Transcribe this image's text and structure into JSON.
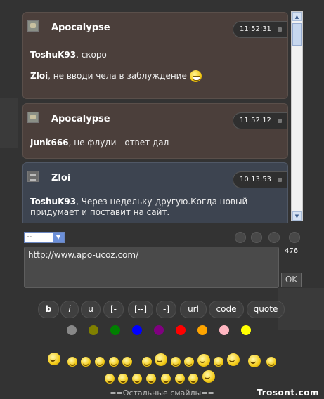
{
  "messages": [
    {
      "author": "Apocalypse",
      "time": "11:52:31",
      "lines": [
        {
          "nick": "ToshuK93",
          "text": ", скоро"
        },
        {
          "nick": "Zloi",
          "text": ", не вводи чела в заблуждение",
          "smiley": "grin-icon"
        }
      ],
      "color": "#4b3f3b"
    },
    {
      "author": "Apocalypse",
      "time": "11:52:12",
      "lines": [
        {
          "nick": "Junk666",
          "text": ", не флуди - ответ дал"
        }
      ],
      "color": "#4b3f3b"
    },
    {
      "author": "Zloi",
      "time": "10:13:53",
      "lines": [
        {
          "nick": "ToshuK93",
          "text": ", Через недельку-другую.Когда новый"
        },
        {
          "nick": "",
          "text": "придумает и поставит на сайт."
        }
      ],
      "color": "#3d4450"
    }
  ],
  "compose": {
    "select_value": "--",
    "input_value": "http://www.apo-ucoz.com/",
    "char_counter": "476",
    "send_label": "OK"
  },
  "format_buttons": [
    "b",
    "i",
    "u",
    "[-",
    "[--]",
    "-]",
    "url",
    "code",
    "quote"
  ],
  "color_dots": [
    "#888888",
    "#808000",
    "#008000",
    "#0000ff",
    "#800080",
    "#ff0000",
    "#ffa500",
    "#ffb6c1",
    "#ffff00"
  ],
  "more_smiles_label": "==Остальные смайлы==",
  "watermark": "Trosont.com"
}
